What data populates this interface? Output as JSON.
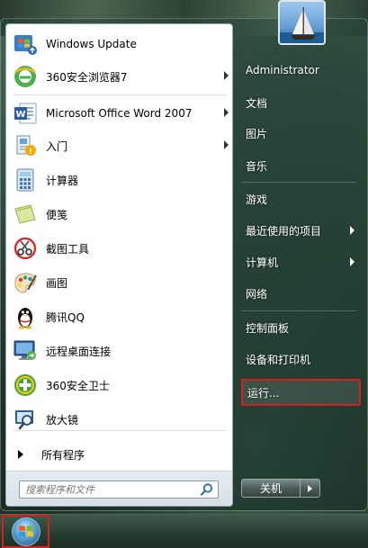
{
  "start_menu": {
    "programs": [
      {
        "label": "Windows Update",
        "icon": "windows-update-icon",
        "has_submenu": false
      },
      {
        "label": "360安全浏览器7",
        "icon": "360-browser-icon",
        "has_submenu": true
      },
      {
        "label": "Microsoft Office Word 2007",
        "icon": "word-icon",
        "has_submenu": true
      },
      {
        "label": "入门",
        "icon": "getting-started-icon",
        "has_submenu": true
      },
      {
        "label": "计算器",
        "icon": "calculator-icon",
        "has_submenu": false
      },
      {
        "label": "便笺",
        "icon": "sticky-notes-icon",
        "has_submenu": false
      },
      {
        "label": "截图工具",
        "icon": "snipping-tool-icon",
        "has_submenu": false
      },
      {
        "label": "画图",
        "icon": "paint-icon",
        "has_submenu": false
      },
      {
        "label": "腾讯QQ",
        "icon": "qq-penguin-icon",
        "has_submenu": false
      },
      {
        "label": "远程桌面连接",
        "icon": "remote-desktop-icon",
        "has_submenu": false
      },
      {
        "label": "360安全卫士",
        "icon": "360-safe-guard-icon",
        "has_submenu": false
      },
      {
        "label": "放大镜",
        "icon": "magnifier-icon",
        "has_submenu": false
      }
    ],
    "all_programs_label": "所有程序",
    "search_placeholder": "搜索程序和文件",
    "right_items": [
      {
        "label": "Administrator",
        "has_submenu": false
      },
      {
        "label": "文档",
        "has_submenu": false
      },
      {
        "label": "图片",
        "has_submenu": false
      },
      {
        "label": "音乐",
        "has_submenu": false
      },
      {
        "label": "游戏",
        "has_submenu": false
      },
      {
        "label": "最近使用的项目",
        "has_submenu": true
      },
      {
        "label": "计算机",
        "has_submenu": true
      },
      {
        "label": "网络",
        "has_submenu": false
      },
      {
        "label": "控制面板",
        "has_submenu": false
      },
      {
        "label": "设备和打印机",
        "has_submenu": false
      },
      {
        "label": "运行...",
        "has_submenu": false,
        "highlighted": true
      }
    ],
    "shutdown_label": "关机"
  },
  "colors": {
    "highlight_border": "#d91e1e",
    "menu_left_bg": "#ffffff"
  }
}
